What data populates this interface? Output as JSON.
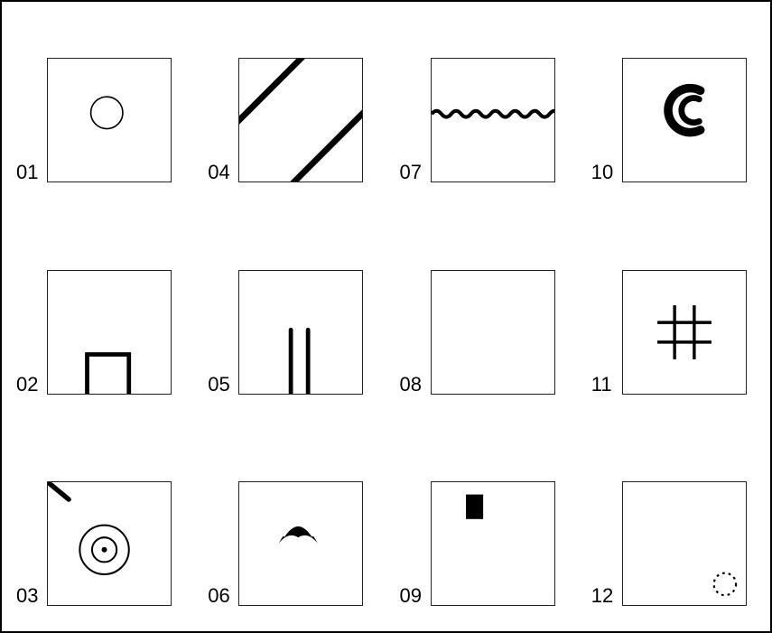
{
  "cells": [
    {
      "id": "01",
      "icon": "circle-outline"
    },
    {
      "id": "02",
      "icon": "open-rectangle-bottom"
    },
    {
      "id": "03",
      "icon": "target-with-tick"
    },
    {
      "id": "04",
      "icon": "two-diagonal-lines"
    },
    {
      "id": "05",
      "icon": "two-vertical-lines"
    },
    {
      "id": "06",
      "icon": "crescent-arc"
    },
    {
      "id": "07",
      "icon": "wavy-line"
    },
    {
      "id": "08",
      "icon": "blank"
    },
    {
      "id": "09",
      "icon": "small-black-rectangle"
    },
    {
      "id": "10",
      "icon": "double-c"
    },
    {
      "id": "11",
      "icon": "hash-grid"
    },
    {
      "id": "12",
      "icon": "dotted-small-circle"
    }
  ]
}
